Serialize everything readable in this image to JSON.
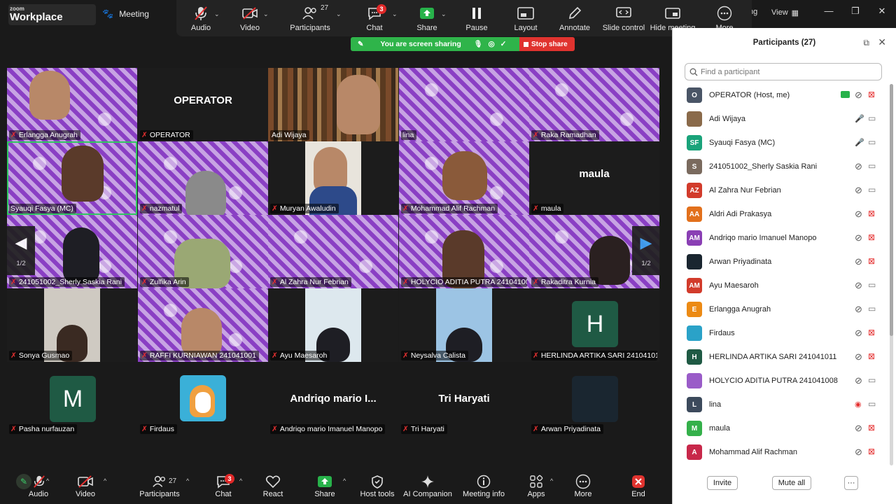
{
  "app": {
    "brand_small": "zoom",
    "brand_name": "Workplace",
    "meeting_tab": "Meeting",
    "view_label": "View"
  },
  "share_toolbar": {
    "items": [
      {
        "label": "Audio",
        "icon": "mic-muted-icon"
      },
      {
        "label": "Video",
        "icon": "camera-off-icon"
      },
      {
        "label": "Participants",
        "icon": "people-icon",
        "count": "27"
      },
      {
        "label": "Chat",
        "icon": "chat-icon",
        "badge": "3"
      },
      {
        "label": "Share",
        "icon": "share-screen-icon"
      },
      {
        "label": "Pause",
        "icon": "pause-icon"
      },
      {
        "label": "Layout",
        "icon": "layout-icon"
      },
      {
        "label": "Annotate",
        "icon": "pen-icon"
      },
      {
        "label": "Slide control",
        "icon": "slide-control-icon"
      },
      {
        "label": "Hide meeting",
        "icon": "hide-icon"
      },
      {
        "label": "More",
        "icon": "more-icon"
      }
    ],
    "banner_text": "You are screen sharing",
    "stop_share": "Stop share",
    "tab_fragment": "ng"
  },
  "gallery": {
    "page_indicator_left": "1/2",
    "page_indicator_right": "1/2",
    "tiles": [
      {
        "name": "Erlangga Anugrah"
      },
      {
        "name": "OPERATOR",
        "display": "OPERATOR"
      },
      {
        "name": "Adi Wijaya"
      },
      {
        "name": "lina"
      },
      {
        "name": "Raka Ramadhan"
      },
      {
        "name": "Syauqi Fasya (MC)"
      },
      {
        "name": "nazmatul"
      },
      {
        "name": "Muryan Awaludin"
      },
      {
        "name": "Mohammad Alif Rachman"
      },
      {
        "name": "maula",
        "display": "maula"
      },
      {
        "name": "241051002_Sherly Saskia Rani"
      },
      {
        "name": "Zulfika Arin"
      },
      {
        "name": "Al Zahra Nur Febrian"
      },
      {
        "name": "HOLYCIO ADITIA PUTRA 241041008"
      },
      {
        "name": "Rakaditra Kurnia"
      },
      {
        "name": "Sonya Gusmao"
      },
      {
        "name": "RAFFI KURNIAWAN 241041001"
      },
      {
        "name": "Ayu Maesaroh"
      },
      {
        "name": "Neysalva Calista"
      },
      {
        "name": "HERLINDA ARTIKA SARI 241041011",
        "initial": "H"
      },
      {
        "name": "Pasha nurfauzan",
        "initial": "M"
      },
      {
        "name": "Firdaus"
      },
      {
        "name": "Andriqo mario Imanuel Manopo",
        "display": "Andriqo mario I..."
      },
      {
        "name": "Tri Haryati",
        "display": "Tri Haryati"
      },
      {
        "name": "Arwan Priyadinata"
      }
    ]
  },
  "bottom_toolbar": {
    "items": [
      {
        "label": "Audio",
        "icon": "mic-muted-icon"
      },
      {
        "label": "Video",
        "icon": "camera-off-icon"
      },
      {
        "label": "Participants",
        "icon": "people-icon",
        "count": "27"
      },
      {
        "label": "Chat",
        "icon": "chat-icon",
        "badge": "3"
      },
      {
        "label": "React",
        "icon": "heart-icon"
      },
      {
        "label": "Share",
        "icon": "share-screen-icon"
      },
      {
        "label": "Host tools",
        "icon": "shield-icon"
      },
      {
        "label": "AI Companion",
        "icon": "sparkle-icon"
      },
      {
        "label": "Meeting info",
        "icon": "info-icon"
      },
      {
        "label": "Apps",
        "icon": "apps-icon"
      },
      {
        "label": "More",
        "icon": "more-icon"
      },
      {
        "label": "End",
        "icon": "end-icon"
      }
    ]
  },
  "participants_panel": {
    "title": "Participants (27)",
    "search_placeholder": "Find a participant",
    "invite_label": "Invite",
    "mute_all_label": "Mute all",
    "more_label": "···",
    "list": [
      {
        "name": "OPERATOR (Host, me)",
        "initials": "O",
        "color": "#4a5566",
        "mic": "muted",
        "video": "off",
        "sharing": true
      },
      {
        "name": "Adi Wijaya",
        "initials": "",
        "color": "#8a6a4a",
        "mic": "on",
        "video": "on"
      },
      {
        "name": "Syauqi Fasya (MC)",
        "initials": "SF",
        "color": "#1aa37a",
        "mic": "on",
        "video": "on"
      },
      {
        "name": "241051002_Sherly Saskia Rani",
        "initials": "S",
        "color": "#7a6a5e",
        "mic": "muted",
        "video": "on"
      },
      {
        "name": "Al Zahra Nur Febrian",
        "initials": "AZ",
        "color": "#d23b2b",
        "mic": "muted",
        "video": "on"
      },
      {
        "name": "Aldri Adi Prakasya",
        "initials": "AA",
        "color": "#e2701c",
        "mic": "muted",
        "video": "off"
      },
      {
        "name": "Andriqo mario Imanuel Manopo",
        "initials": "AM",
        "color": "#8a3fb4",
        "mic": "muted",
        "video": "off"
      },
      {
        "name": "Arwan Priyadinata",
        "initials": "",
        "color": "#1a2630",
        "mic": "muted",
        "video": "off"
      },
      {
        "name": "Ayu Maesaroh",
        "initials": "AM",
        "color": "#d23b2b",
        "mic": "muted",
        "video": "on"
      },
      {
        "name": "Erlangga Anugrah",
        "initials": "E",
        "color": "#ec8a14",
        "mic": "muted",
        "video": "on"
      },
      {
        "name": "Firdaus",
        "initials": "",
        "color": "#2aa2c8",
        "mic": "muted",
        "video": "off"
      },
      {
        "name": "HERLINDA ARTIKA SARI 241041011",
        "initials": "H",
        "color": "#1f5a44",
        "mic": "muted",
        "video": "off"
      },
      {
        "name": "HOLYCIO ADITIA PUTRA 241041008",
        "initials": "",
        "color": "#9a5cc8",
        "mic": "muted",
        "video": "on"
      },
      {
        "name": "lina",
        "initials": "L",
        "color": "#3c4a5c",
        "mic": "active",
        "video": "on"
      },
      {
        "name": "maula",
        "initials": "M",
        "color": "#34b04a",
        "mic": "muted",
        "video": "off"
      },
      {
        "name": "Mohammad Alif Rachman",
        "initials": "A",
        "color": "#c8284a",
        "mic": "muted",
        "video": "off"
      }
    ]
  }
}
